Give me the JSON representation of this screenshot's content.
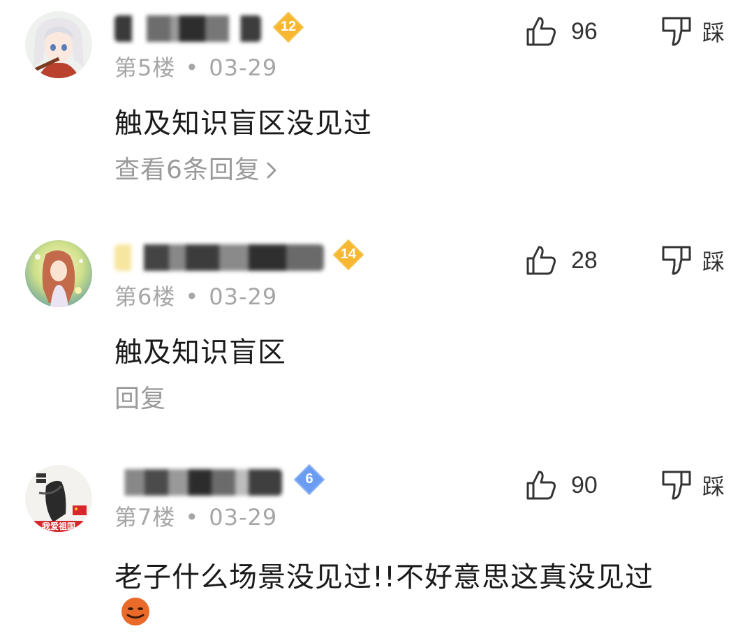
{
  "comments": [
    {
      "floor": "第5楼",
      "date": "03-29",
      "level": "12",
      "content": "触及知识盲区没见过",
      "reply_text": "查看6条回复",
      "likes": "96",
      "dislike_label": "踩",
      "badge_color": "#f7b731"
    },
    {
      "floor": "第6楼",
      "date": "03-29",
      "level": "14",
      "content": "触及知识盲区",
      "reply_text": "回复",
      "likes": "28",
      "dislike_label": "踩",
      "badge_color": "#f7b731"
    },
    {
      "floor": "第7楼",
      "date": "03-29",
      "level": "6",
      "content": "老子什么场景没见过!!不好意思这真没见过",
      "emoji": "grinning-emoji",
      "likes": "90",
      "dislike_label": "踩",
      "badge_color": "#6a9cf2",
      "avatar_banner": "我爱祖国"
    }
  ],
  "separator": "•",
  "icons": {
    "like": "thumbs-up-icon",
    "dislike": "thumbs-down-icon",
    "chevron": "chevron-right-icon"
  }
}
